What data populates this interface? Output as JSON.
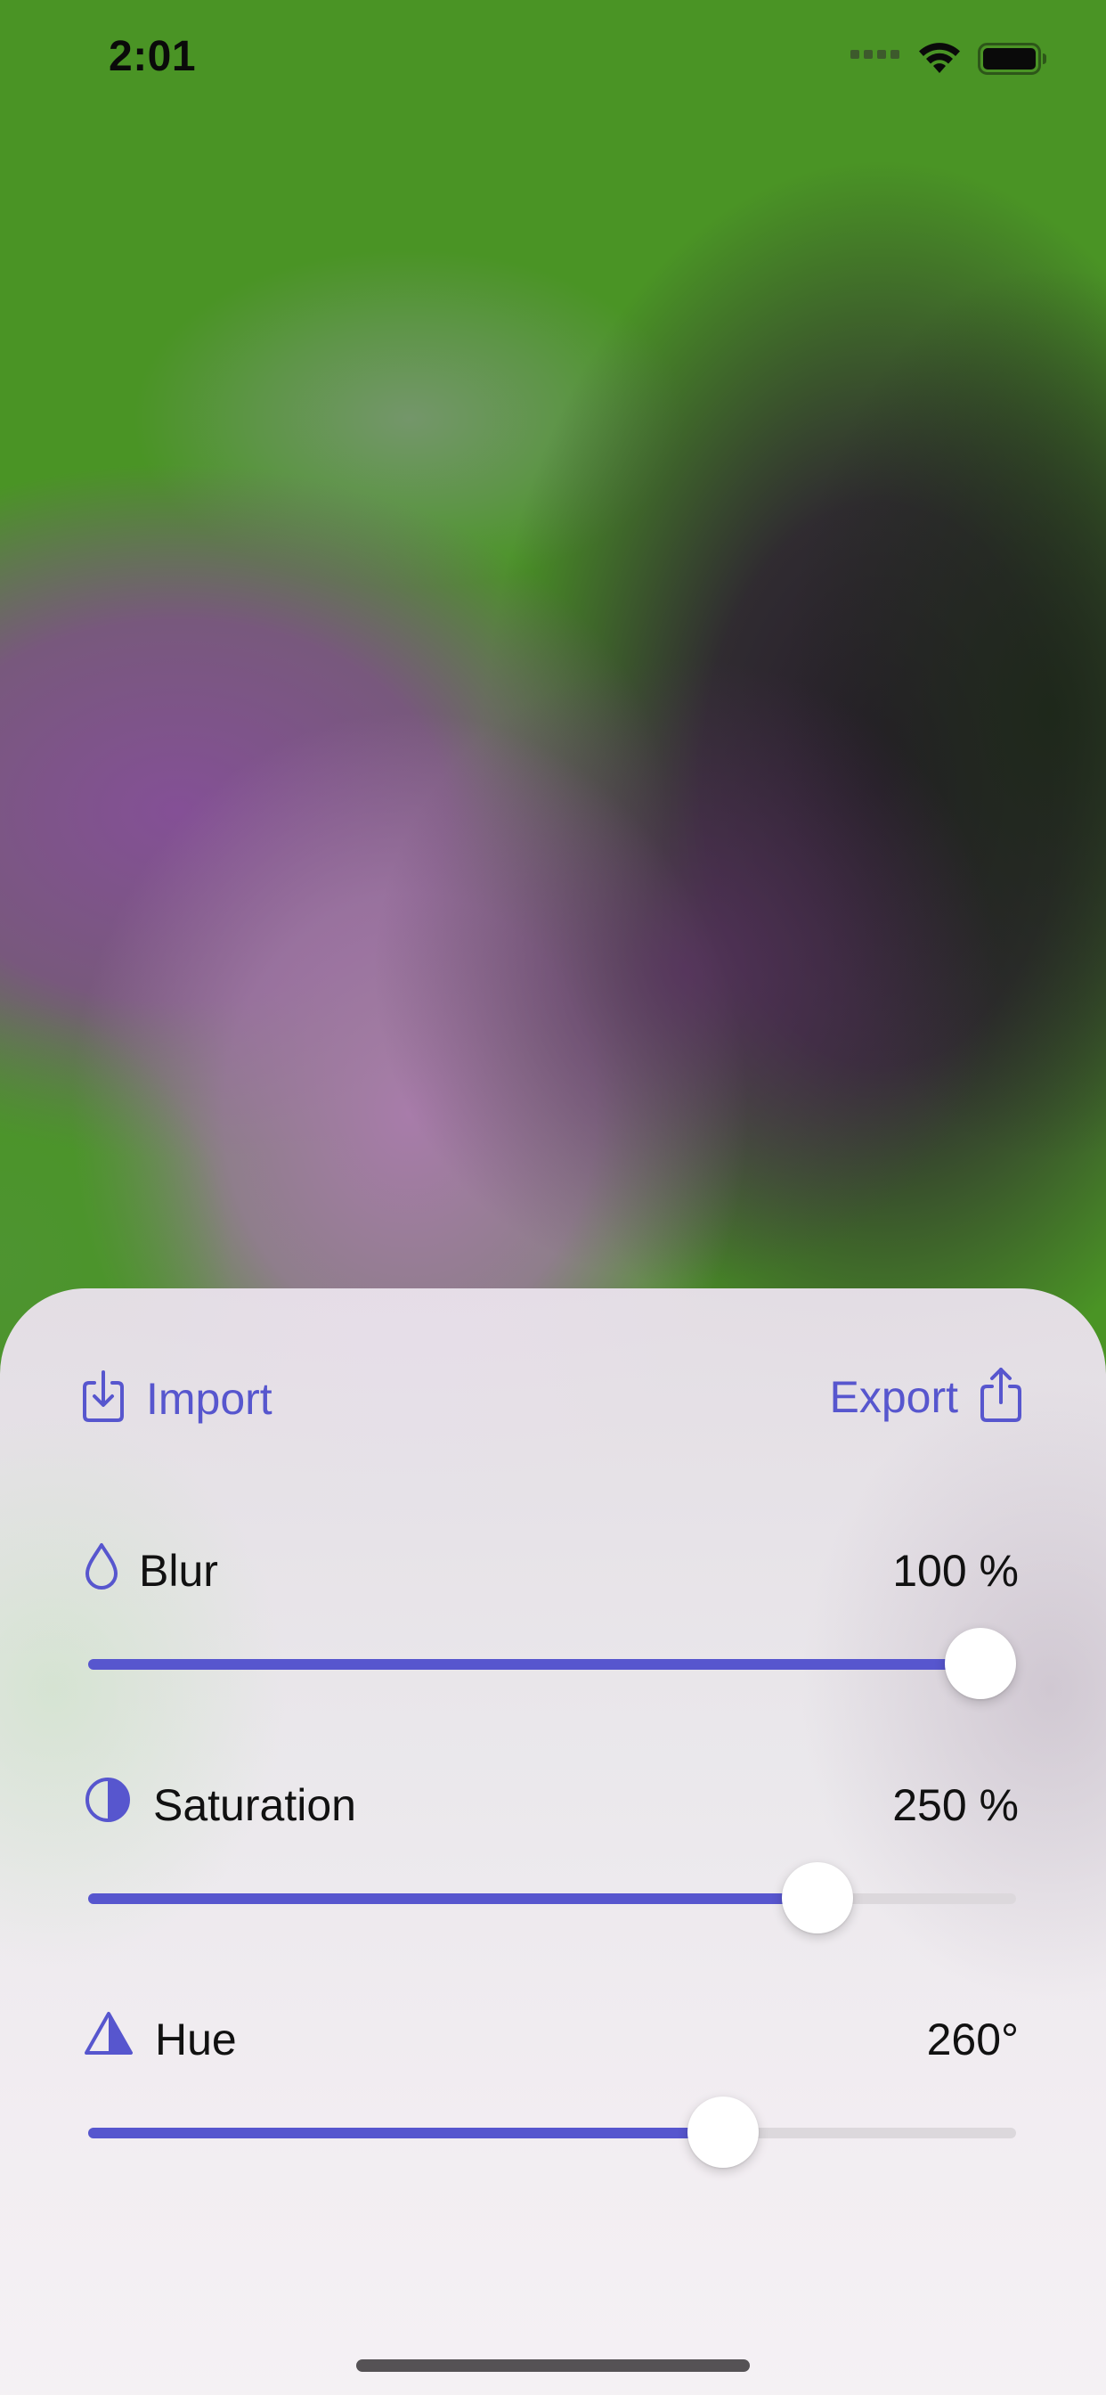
{
  "status_bar": {
    "time": "2:01"
  },
  "actions": {
    "import_label": "Import",
    "export_label": "Export"
  },
  "controls": [
    {
      "label": "Blur",
      "value_text": "100 %",
      "level": 1.0,
      "icon": "drop-icon"
    },
    {
      "label": "Saturation",
      "value_text": "250 %",
      "level": 0.81,
      "icon": "half-circle-icon"
    },
    {
      "label": "Hue",
      "value_text": "260°",
      "level": 0.7,
      "icon": "triangle-half-icon"
    }
  ],
  "colors": {
    "accent": "#5756ce",
    "track": "#dcd8dc",
    "text": "#111111"
  }
}
